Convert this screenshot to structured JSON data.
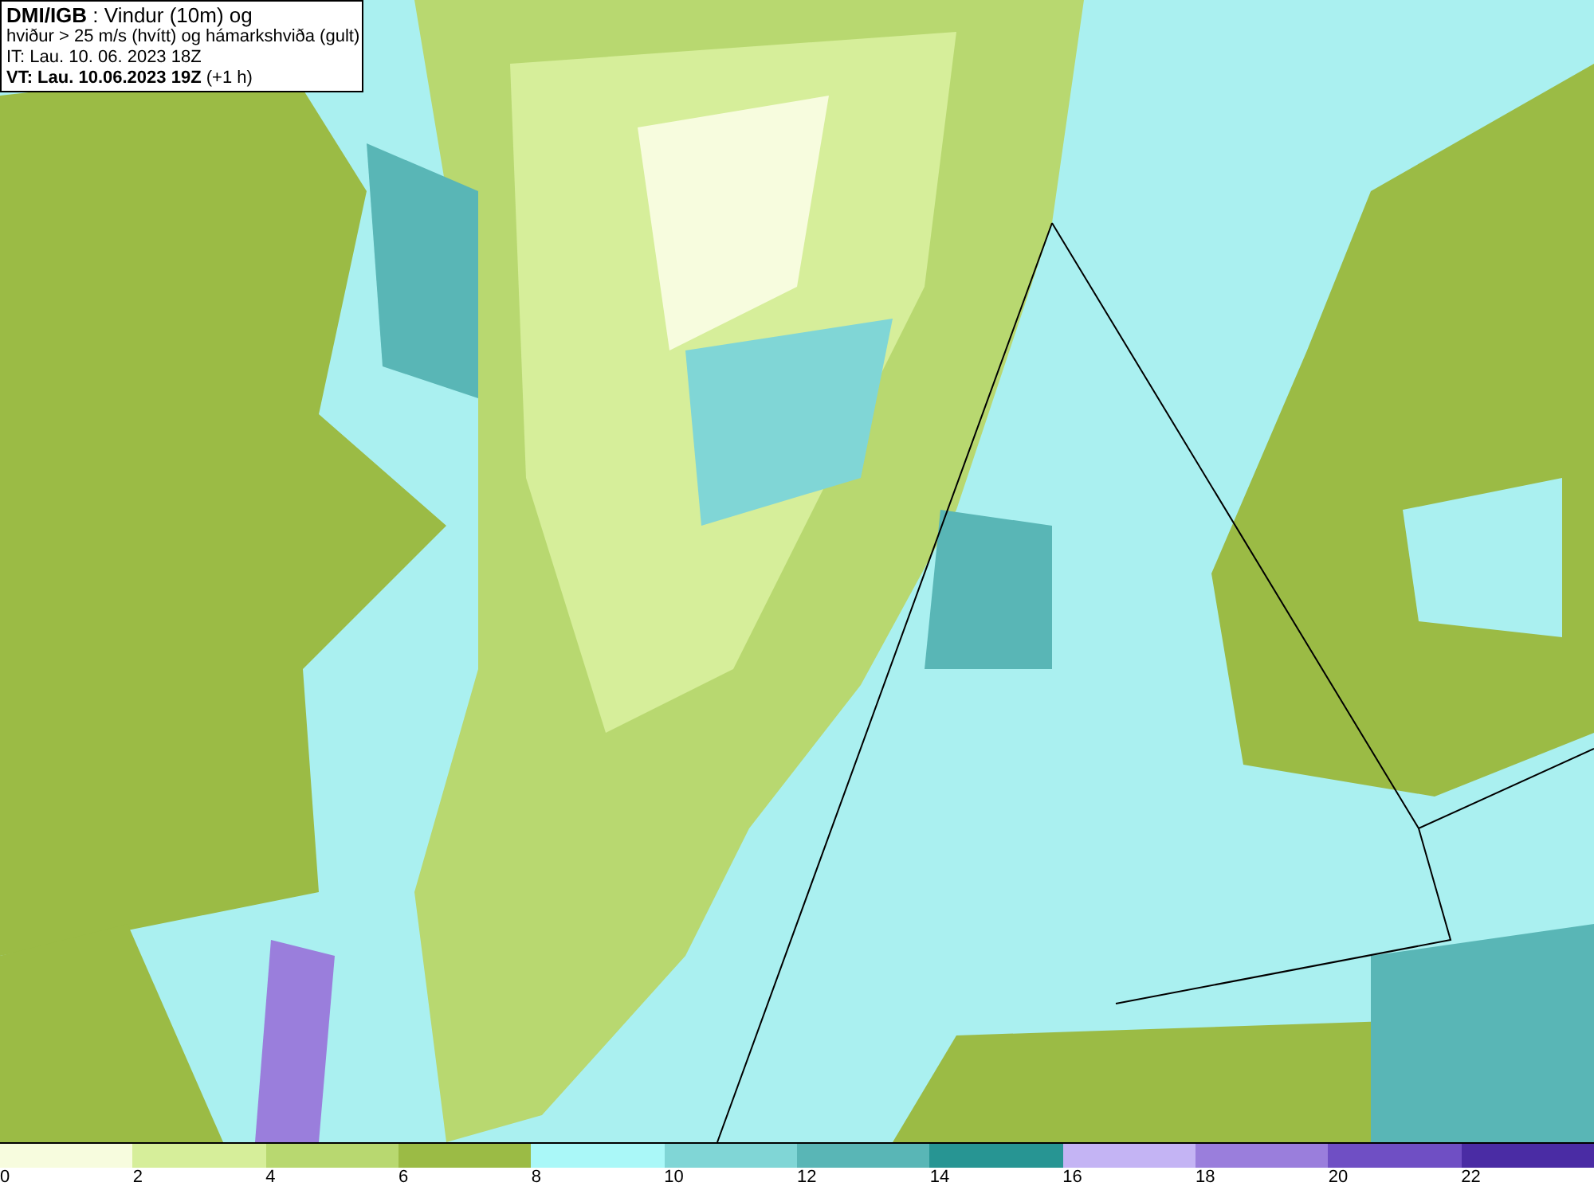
{
  "title_box": {
    "lines": [
      "**DMI/IGB** : Vindur (10m) og",
      "hviður > 25 m/s (hvítt) og hámarkshviða (gult)",
      "IT: Lau. 10. 06. 2023 18Z",
      "**VT: Lau. 10.06.2023 19Z** (+1 h)"
    ]
  },
  "legend": {
    "bins": [
      {
        "color": "#f7fcde"
      },
      {
        "color": "#d6ee9a"
      },
      {
        "color": "#b8d870"
      },
      {
        "color": "#9bbb45"
      },
      {
        "color": "#aaf8f8"
      },
      {
        "color": "#80d6d6"
      },
      {
        "color": "#59b6b6"
      },
      {
        "color": "#279593"
      },
      {
        "color": "#c4b4f4"
      },
      {
        "color": "#9a7edc"
      },
      {
        "color": "#6f4fc4"
      },
      {
        "color": "#4a2ca4"
      }
    ],
    "ticks": [
      "0",
      "2",
      "4",
      "6",
      "8",
      "10",
      "12",
      "14",
      "16",
      "18",
      "20",
      "22"
    ]
  }
}
